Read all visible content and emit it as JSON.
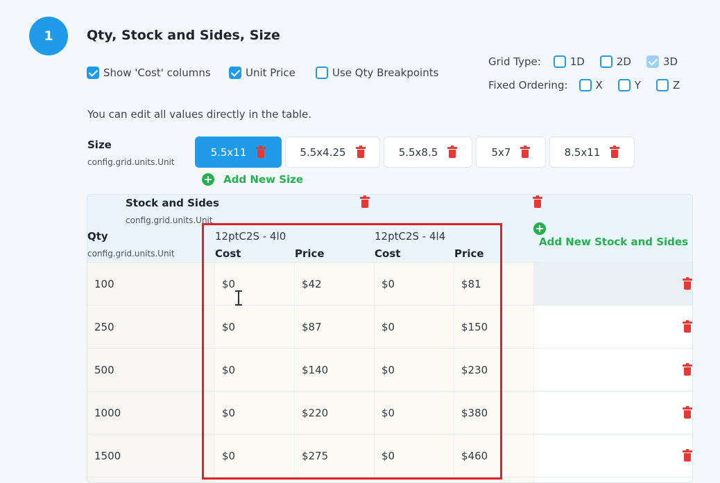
{
  "step": {
    "number": "1",
    "title": "Qty, Stock and Sides, Size"
  },
  "options": {
    "show_cost": {
      "label": "Show 'Cost' columns",
      "checked": true
    },
    "unit_price": {
      "label": "Unit Price",
      "checked": true
    },
    "qty_breakpoints": {
      "label": "Use Qty Breakpoints",
      "checked": false
    }
  },
  "grid_type": {
    "label": "Grid Type:",
    "options": [
      {
        "label": "1D",
        "checked": false
      },
      {
        "label": "2D",
        "checked": false
      },
      {
        "label": "3D",
        "checked": true
      }
    ]
  },
  "fixed_ordering": {
    "label": "Fixed Ordering:",
    "options": [
      {
        "label": "X",
        "checked": false
      },
      {
        "label": "Y",
        "checked": false
      },
      {
        "label": "Z",
        "checked": false
      }
    ]
  },
  "hint": "You can edit all values directly in the table.",
  "size": {
    "label": "Size",
    "sublabel": "config.grid.units.Unit",
    "chips": [
      "5.5x11",
      "5.5x4.25",
      "5.5x8.5",
      "5x7",
      "8.5x11"
    ],
    "active_index": 0,
    "add_label": "Add New Size"
  },
  "table": {
    "stock_label": "Stock and Sides",
    "stock_sublabel": "config.grid.units.Unit",
    "qty_label": "Qty",
    "qty_sublabel": "config.grid.units.Unit",
    "add_stock_label": "Add New Stock and Sides",
    "stocks": [
      {
        "name": "12ptC2S - 4l0",
        "cost_label": "Cost",
        "price_label": "Price"
      },
      {
        "name": "12ptC2S - 4l4",
        "cost_label": "Cost",
        "price_label": "Price"
      }
    ],
    "rows": [
      {
        "qty": "100",
        "values": [
          "$0",
          "$42",
          "$0",
          "$81"
        ]
      },
      {
        "qty": "250",
        "values": [
          "$0",
          "$87",
          "$0",
          "$150"
        ]
      },
      {
        "qty": "500",
        "values": [
          "$0",
          "$140",
          "$0",
          "$230"
        ]
      },
      {
        "qty": "1000",
        "values": [
          "$0",
          "$220",
          "$0",
          "$380"
        ]
      },
      {
        "qty": "1500",
        "values": [
          "$0",
          "$275",
          "$0",
          "$460"
        ]
      }
    ]
  },
  "colors": {
    "accent": "#1f9bea",
    "delete": "#e53935",
    "add": "#22b14c",
    "highlight": "#e0202a"
  }
}
